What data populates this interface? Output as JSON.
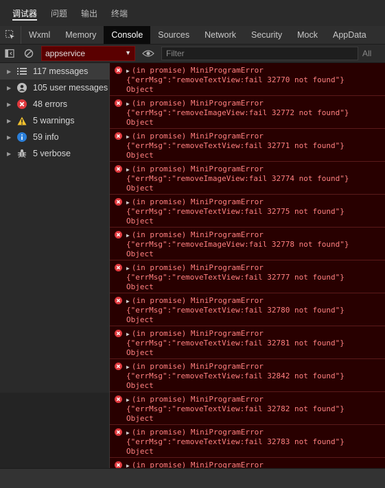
{
  "panel_tabs": [
    "调试器",
    "问题",
    "输出",
    "终端"
  ],
  "dev_tabs": [
    "Wxml",
    "Memory",
    "Console",
    "Sources",
    "Network",
    "Security",
    "Mock",
    "AppData"
  ],
  "toolbar": {
    "context": "appservice",
    "filter_placeholder": "Filter",
    "levels_label": "All"
  },
  "sidebar": {
    "items": [
      {
        "label": "117 messages",
        "icon": "list-icon"
      },
      {
        "label": "105 user messages",
        "icon": "user-icon"
      },
      {
        "label": "48 errors",
        "icon": "error-icon"
      },
      {
        "label": "5 warnings",
        "icon": "warning-icon"
      },
      {
        "label": "59 info",
        "icon": "info-icon"
      },
      {
        "label": "5 verbose",
        "icon": "bug-icon"
      }
    ]
  },
  "messages": [
    {
      "line1": "(in promise) MiniProgramError",
      "line2": "{\"errMsg\":\"removeTextView:fail 32770 not found\"}",
      "line3": "Object"
    },
    {
      "line1": "(in promise) MiniProgramError",
      "line2": "{\"errMsg\":\"removeImageView:fail 32772 not found\"}",
      "line3": "Object"
    },
    {
      "line1": "(in promise) MiniProgramError",
      "line2": "{\"errMsg\":\"removeTextView:fail 32771 not found\"}",
      "line3": "Object"
    },
    {
      "line1": "(in promise) MiniProgramError",
      "line2": "{\"errMsg\":\"removeImageView:fail 32774 not found\"}",
      "line3": "Object"
    },
    {
      "line1": "(in promise) MiniProgramError",
      "line2": "{\"errMsg\":\"removeTextView:fail 32775 not found\"}",
      "line3": "Object"
    },
    {
      "line1": "(in promise) MiniProgramError",
      "line2": "{\"errMsg\":\"removeImageView:fail 32778 not found\"}",
      "line3": "Object"
    },
    {
      "line1": "(in promise) MiniProgramError",
      "line2": "{\"errMsg\":\"removeTextView:fail 32777 not found\"}",
      "line3": "Object"
    },
    {
      "line1": "(in promise) MiniProgramError",
      "line2": "{\"errMsg\":\"removeTextView:fail 32780 not found\"}",
      "line3": "Object"
    },
    {
      "line1": "(in promise) MiniProgramError",
      "line2": "{\"errMsg\":\"removeTextView:fail 32781 not found\"}",
      "line3": "Object"
    },
    {
      "line1": "(in promise) MiniProgramError",
      "line2": "{\"errMsg\":\"removeTextView:fail 32842 not found\"}",
      "line3": "Object"
    },
    {
      "line1": "(in promise) MiniProgramError",
      "line2": "{\"errMsg\":\"removeTextView:fail 32782 not found\"}",
      "line3": "Object"
    },
    {
      "line1": "(in promise) MiniProgramError",
      "line2": "{\"errMsg\":\"removeTextView:fail 32783 not found\"}",
      "line3": "Object"
    },
    {
      "line1": "(in promise) MiniProgramError",
      "line2": "",
      "line3": ""
    }
  ],
  "colors": {
    "error_text": "#ff8080",
    "error_bg": "#280000",
    "context_bg": "#5a0000"
  }
}
